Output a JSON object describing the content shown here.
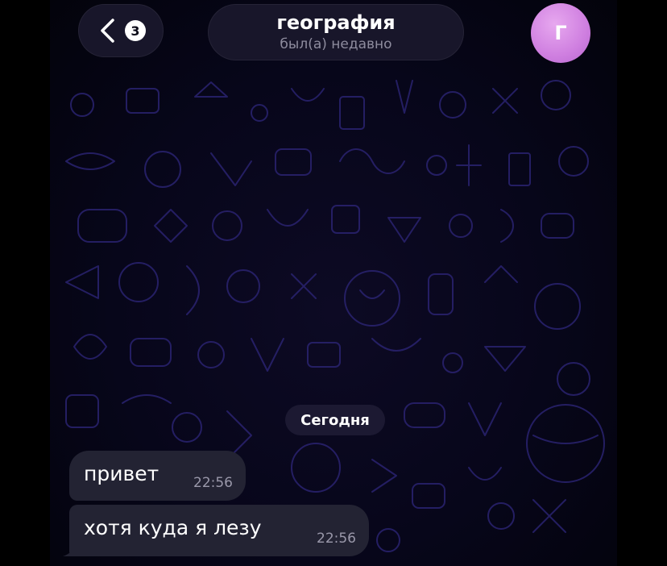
{
  "header": {
    "back_badge_count": "3",
    "title": "география",
    "status": "был(а) недавно",
    "avatar_letter": "Г",
    "avatar_color": "#d48be4"
  },
  "chat": {
    "date_separator": "Сегодня",
    "messages": [
      {
        "text": "привет",
        "time": "22:56"
      },
      {
        "text": "хотя куда я лезу",
        "time": "22:56"
      }
    ]
  },
  "icons": {
    "back": "chevron-left-icon"
  },
  "colors": {
    "background": "#000000",
    "bubble": "#232333",
    "pill": "#1a182c",
    "doodle": "#2a2370"
  }
}
